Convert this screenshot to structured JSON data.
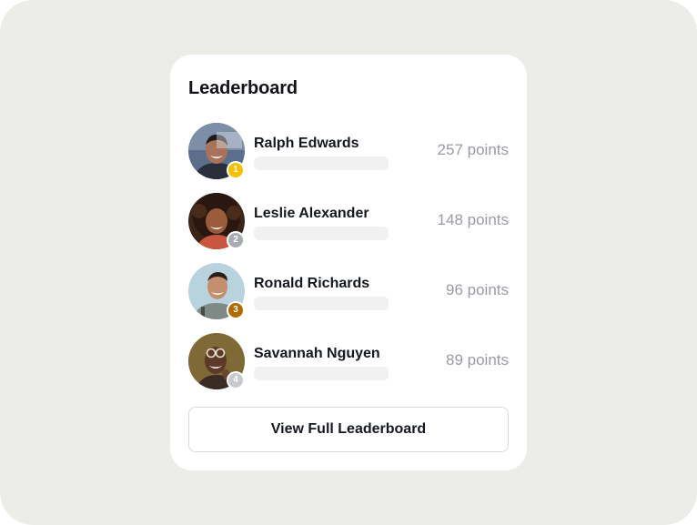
{
  "card": {
    "title": "Leaderboard",
    "button_label": "View Full Leaderboard"
  },
  "entries": [
    {
      "rank": "1",
      "name": "Ralph Edwards",
      "points": "257 points",
      "rank_color": "#f5c000",
      "avatar_icon": "man-smiling-avatar"
    },
    {
      "rank": "2",
      "name": "Leslie Alexander",
      "points": "148 points",
      "rank_color": "#a9abb3",
      "avatar_icon": "woman-curly-hair-avatar"
    },
    {
      "rank": "3",
      "name": "Ronald Richards",
      "points": "96 points",
      "rank_color": "#b36a00",
      "avatar_icon": "man-casual-avatar"
    },
    {
      "rank": "4",
      "name": "Savannah Nguyen",
      "points": "89 points",
      "rank_color": "#c8c9cd",
      "avatar_icon": "woman-glasses-avatar"
    }
  ]
}
